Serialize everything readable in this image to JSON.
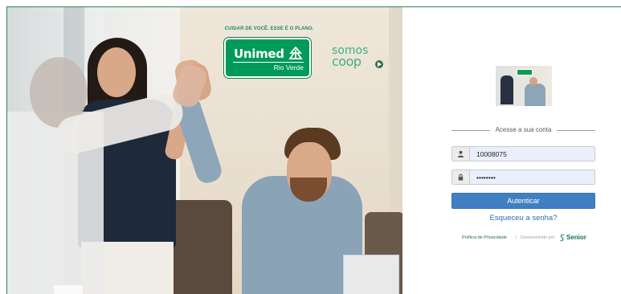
{
  "hero": {
    "tagline": "CUIDAR DE VOCÊ. ESSE É O PLANO.",
    "brand_name": "Unimed",
    "brand_sub": "Rio Verde",
    "somos": "somos",
    "coop": "coop"
  },
  "login": {
    "section_title": "Acesse a sua conta",
    "username_value": "10008075",
    "password_value": "••••••••",
    "submit_label": "Autenticar",
    "forgot_label": "Esqueceu a senha?"
  },
  "footer": {
    "privacy_label": "Política de Privacidade",
    "separator": "|",
    "developed_by": "Desenvolvido por",
    "vendor": "Senior"
  },
  "colors": {
    "brand_green": "#009a5a",
    "button_blue": "#3f7fc2",
    "link_blue": "#2f6db0",
    "input_bg": "#eaf0fb"
  },
  "icons": {
    "username": "user-icon",
    "password": "lock-icon",
    "vendor": "senior-logo-icon"
  }
}
